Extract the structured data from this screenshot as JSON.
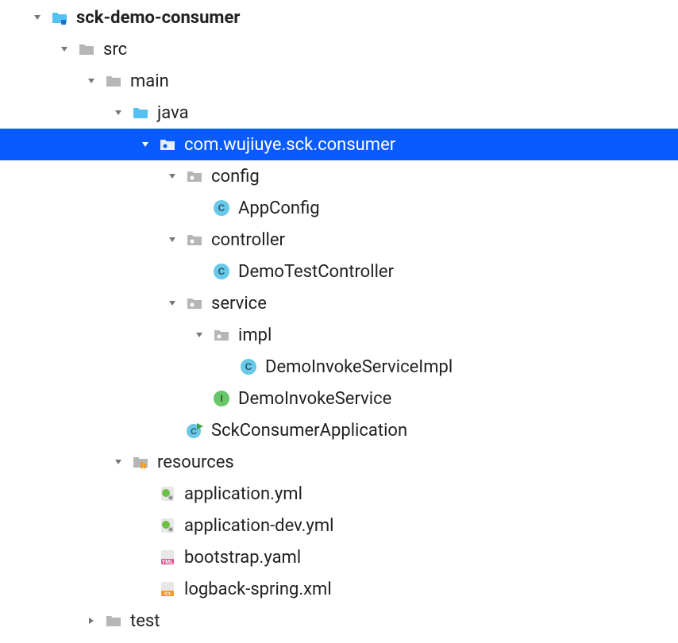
{
  "node0": {
    "label": "sck-demo-consumer"
  },
  "node1": {
    "label": "src"
  },
  "node2": {
    "label": "main"
  },
  "node3": {
    "label": "java"
  },
  "node4": {
    "label": "com.wujiuye.sck.consumer"
  },
  "node5": {
    "label": "config"
  },
  "node6": {
    "label": "AppConfig"
  },
  "node7": {
    "label": "controller"
  },
  "node8": {
    "label": "DemoTestController"
  },
  "node9": {
    "label": "service"
  },
  "node10": {
    "label": "impl"
  },
  "node11": {
    "label": "DemoInvokeServiceImpl"
  },
  "node12": {
    "label": "DemoInvokeService"
  },
  "node13": {
    "label": "SckConsumerApplication"
  },
  "node14": {
    "label": "resources"
  },
  "node15": {
    "label": "application.yml"
  },
  "node16": {
    "label": "application-dev.yml"
  },
  "node17": {
    "label": "bootstrap.yaml"
  },
  "node18": {
    "label": "logback-spring.xml"
  },
  "node19": {
    "label": "test"
  }
}
